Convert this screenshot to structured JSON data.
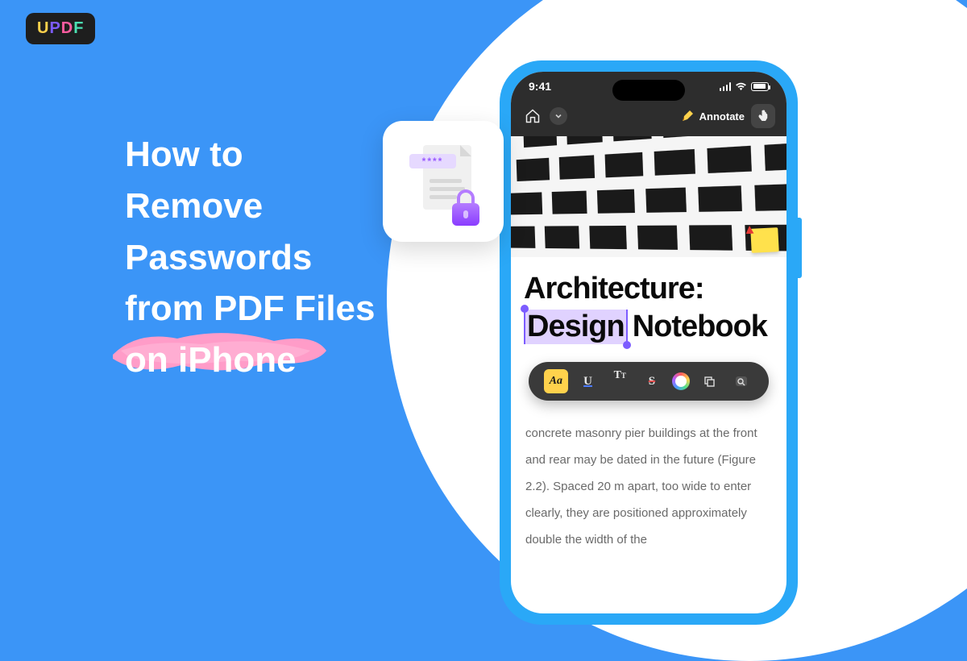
{
  "logo": {
    "u": "U",
    "p": "P",
    "d": "D",
    "f": "F"
  },
  "heading": {
    "line1": "How to",
    "line2": "Remove",
    "line3": "Passwords",
    "line4": "from PDF Files",
    "line5": "on iPhone"
  },
  "lock": {
    "stars": "****"
  },
  "phone": {
    "status": {
      "time": "9:41"
    },
    "appbar": {
      "annotate": "Annotate"
    },
    "doc": {
      "title_line1": "Architecture:",
      "title_sel": "Design",
      "title_rest": "Notebook",
      "paragraph": "concrete masonry pier buildings at the front and rear may be dated in the future (Figure 2.2). Spaced 20 m apart, too wide to enter clearly, they are positioned approximately double the width of the"
    },
    "toolbar": {
      "aa": "Aa",
      "u": "U",
      "t": "T",
      "t_sub": "T",
      "strike": "S"
    }
  }
}
